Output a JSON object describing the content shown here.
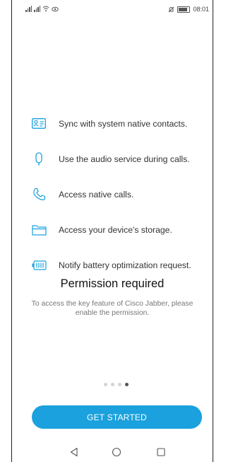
{
  "status_bar": {
    "time": "08:01",
    "battery_label": "100",
    "icons": [
      "signal-icon",
      "signal-icon",
      "wifi-icon",
      "eye-icon",
      "mute-icon",
      "battery-icon"
    ]
  },
  "permissions": [
    {
      "icon": "contacts-card-icon",
      "label": "Sync with system native contacts."
    },
    {
      "icon": "microphone-icon",
      "label": "Use the audio service during calls."
    },
    {
      "icon": "phone-icon",
      "label": "Access native calls."
    },
    {
      "icon": "folder-icon",
      "label": "Access your device's storage."
    },
    {
      "icon": "battery-optimization-icon",
      "label": "Notify battery optimization request."
    }
  ],
  "title": "Permission required",
  "description": "To access the key feature of Cisco Jabber, please enable the permission.",
  "pager": {
    "count": 4,
    "active": 4
  },
  "cta_label": "GET STARTED",
  "colors": {
    "accent": "#1aa1de",
    "icon": "#1aa1de"
  },
  "nav_icons": [
    "back-icon",
    "home-icon",
    "recents-icon"
  ]
}
